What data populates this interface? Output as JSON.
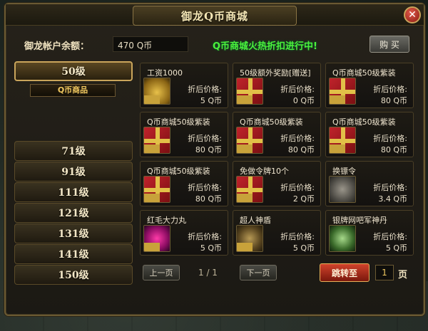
{
  "window": {
    "title": "御龙Q币商城",
    "close": "✕"
  },
  "balance": {
    "label": "御龙帐户余额：",
    "value": "470 Q币",
    "promo": "Q币商城火热折扣进行中!",
    "buy_label": "购 买"
  },
  "levels": {
    "active": "50级",
    "sub": "Q币商品",
    "others": [
      "71级",
      "91级",
      "111级",
      "121级",
      "131级",
      "141级",
      "150级"
    ]
  },
  "price_label": "折后价格:",
  "items": [
    {
      "name": "工资1000",
      "price": "5 Q币",
      "icon": "gold-ingot-icon"
    },
    {
      "name": "50级额外奖励[赠送]",
      "price": "0 Q币",
      "icon": "gift-box-icon"
    },
    {
      "name": "Q币商城50级紫装",
      "price": "80 Q币",
      "icon": "gift-box-icon"
    },
    {
      "name": "Q币商城50级紫装",
      "price": "80 Q币",
      "icon": "gift-box-icon"
    },
    {
      "name": "Q币商城50级紫装",
      "price": "80 Q币",
      "icon": "gift-box-icon"
    },
    {
      "name": "Q币商城50级紫装",
      "price": "80 Q币",
      "icon": "gift-box-icon"
    },
    {
      "name": "Q币商城50级紫装",
      "price": "80 Q币",
      "icon": "gift-box-icon"
    },
    {
      "name": "免做令牌10个",
      "price": "2 Q币",
      "icon": "gift-box-icon"
    },
    {
      "name": "换镖令",
      "price": "3.4 Q币",
      "icon": "token-coin-icon"
    },
    {
      "name": "红毛大力丸",
      "price": "5 Q币",
      "icon": "pink-pill-icon"
    },
    {
      "name": "超人神盾",
      "price": "5 Q币",
      "icon": "shield-icon"
    },
    {
      "name": "银牌网吧军神丹",
      "price": "5 Q币",
      "icon": "green-pill-icon"
    }
  ],
  "pager": {
    "prev": "上一页",
    "info": "1 / 1",
    "next": "下一页",
    "jump": "跳转至",
    "page_value": "1",
    "page_unit": "页"
  }
}
